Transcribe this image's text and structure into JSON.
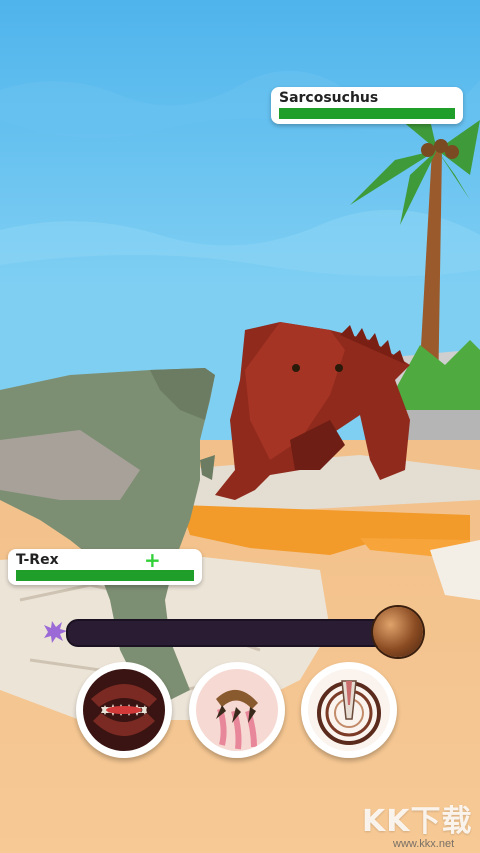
{
  "enemy": {
    "name": "Sarcosuchus",
    "health": 1.0,
    "bar_color": "#1f9e2a"
  },
  "player": {
    "name": "T-Rex",
    "health": 1.0,
    "heal_icon": "heal-plus-icon",
    "bar_color": "#1f9e2a"
  },
  "rage_meter": {
    "level": 0.0,
    "icon": "rage-burst-icon",
    "orb_icon": "rage-orb-icon"
  },
  "skills": [
    {
      "name": "bite",
      "icon": "bite-jaws-icon"
    },
    {
      "name": "claw",
      "icon": "claw-slash-icon"
    },
    {
      "name": "stomp",
      "icon": "stomp-target-icon"
    }
  ],
  "watermark": {
    "brand": "KK下载",
    "url": "www.kkx.net"
  }
}
